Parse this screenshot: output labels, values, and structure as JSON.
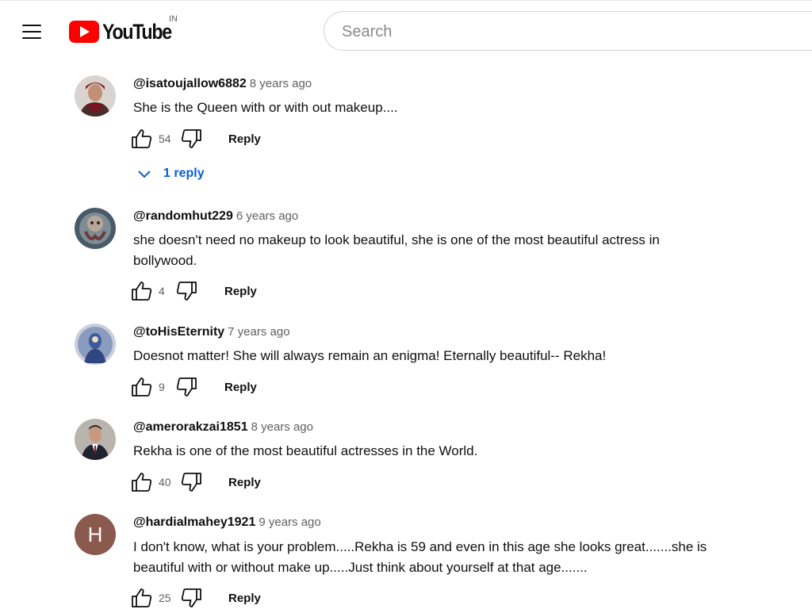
{
  "header": {
    "logo_text": "YouTube",
    "region": "IN",
    "search_placeholder": "Search"
  },
  "comments": [
    {
      "author": "@isatoujallow6882",
      "time": "8 years ago",
      "text": "She is the Queen with or with out makeup....",
      "likes": "54",
      "reply_label": "Reply",
      "replies_label": "1 reply"
    },
    {
      "author": "@randomhut229",
      "time": "6 years ago",
      "text": "she doesn't need no makeup to look beautiful, she is one of the most beautiful actress in bollywood.",
      "likes": "4",
      "reply_label": "Reply"
    },
    {
      "author": "@toHisEternity",
      "time": "7 years ago",
      "text": "Doesnot matter! She will always remain an enigma! Eternally beautiful-- Rekha!",
      "likes": "9",
      "reply_label": "Reply"
    },
    {
      "author": "@amerorakzai1851",
      "time": "8 years ago",
      "text": "Rekha is one of the most beautiful actresses in the World.",
      "likes": "40",
      "reply_label": "Reply"
    },
    {
      "author": "@hardialmahey1921",
      "time": "9 years ago",
      "text": "I don't know, what is your problem.....Rekha is 59 and even in this age she looks great.......she is beautiful with or without make up.....Just think about yourself at that age.......",
      "likes": "25",
      "reply_label": "Reply",
      "avatar_letter": "H"
    }
  ],
  "colors": {
    "brand_red": "#ff0000",
    "link_blue": "#065fd4",
    "avatar_letter_bg": "#8a5a4e"
  }
}
